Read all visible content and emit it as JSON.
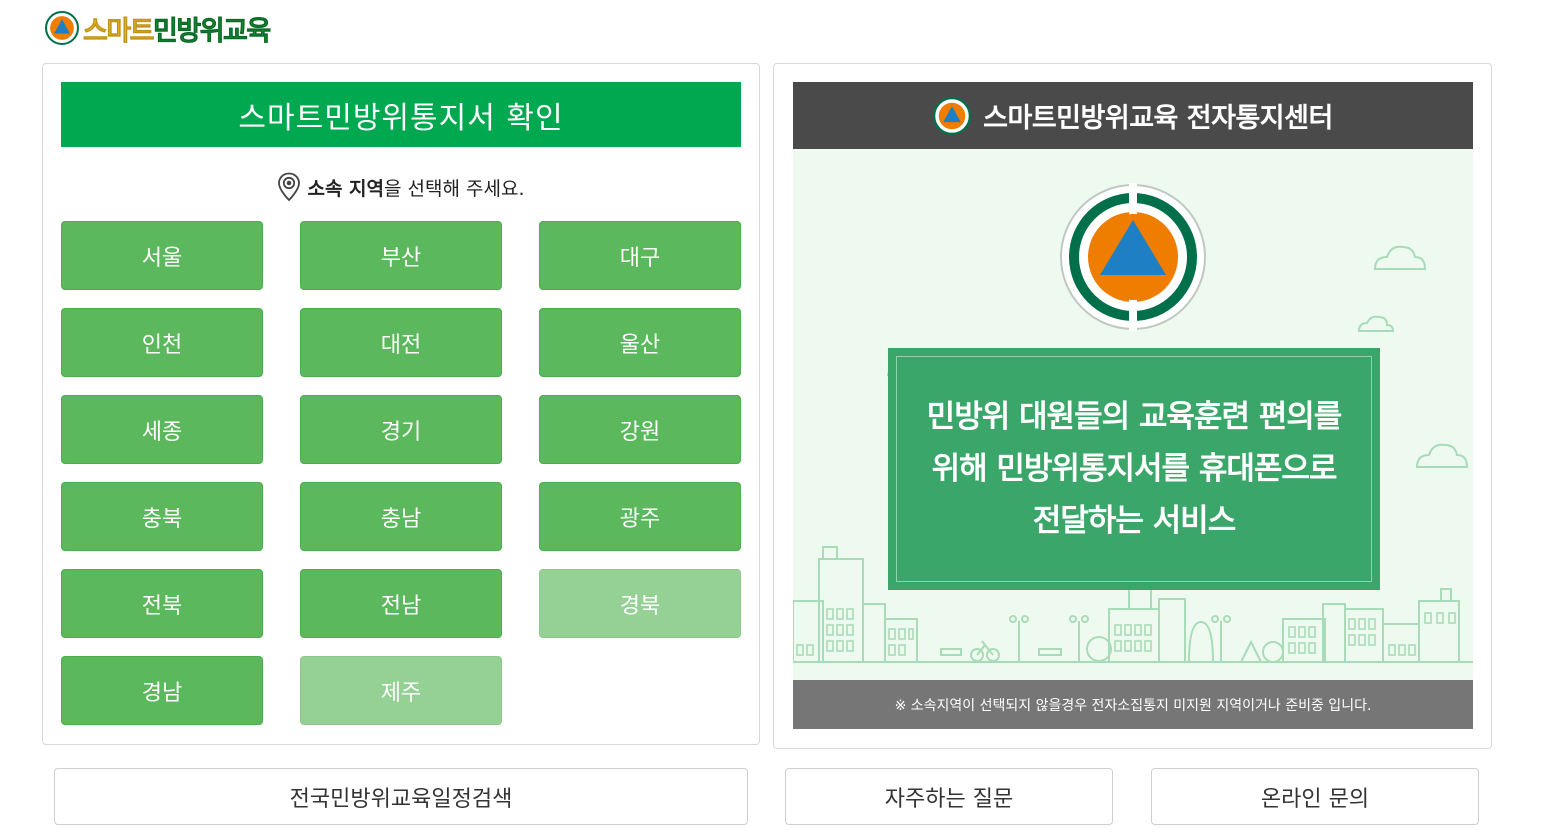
{
  "logo": {
    "text_highlight": "스마트",
    "text_rest": "민방위교육"
  },
  "left_panel": {
    "title": "스마트민방위통지서 확인",
    "prompt_bold": "소속 지역",
    "prompt_rest": "을 선택해 주세요.",
    "regions": [
      {
        "label": "서울",
        "enabled": true
      },
      {
        "label": "부산",
        "enabled": true
      },
      {
        "label": "대구",
        "enabled": true
      },
      {
        "label": "인천",
        "enabled": true
      },
      {
        "label": "대전",
        "enabled": true
      },
      {
        "label": "울산",
        "enabled": true
      },
      {
        "label": "세종",
        "enabled": true
      },
      {
        "label": "경기",
        "enabled": true
      },
      {
        "label": "강원",
        "enabled": true
      },
      {
        "label": "충북",
        "enabled": true
      },
      {
        "label": "충남",
        "enabled": true
      },
      {
        "label": "광주",
        "enabled": true
      },
      {
        "label": "전북",
        "enabled": true
      },
      {
        "label": "전남",
        "enabled": true
      },
      {
        "label": "경북",
        "enabled": false
      },
      {
        "label": "경남",
        "enabled": true
      },
      {
        "label": "제주",
        "enabled": false
      }
    ]
  },
  "right_panel": {
    "title": "스마트민방위교육 전자통지센터",
    "description_lines": [
      "민방위 대원들의 교육훈련 편의를",
      "위해 민방위통지서를 휴대폰으로",
      "전달하는 서비스"
    ],
    "notice": "※ 소속지역이 선택되지 않을경우 전자소집통지 미지원 지역이거나 준비중 입니다."
  },
  "bottom_buttons": {
    "schedule": "전국민방위교육일정검색",
    "faq": "자주하는 질문",
    "inquiry": "온라인 문의"
  },
  "colors": {
    "primary_green": "#00a84f",
    "region_button": "#5cb85c",
    "region_button_disabled": "#95d195",
    "header_dark": "#4a4a4a",
    "notice_bar": "#767676",
    "emblem_orange": "#ef7d00",
    "emblem_blue": "#1e7fc5",
    "emblem_green": "#00704a"
  },
  "icons": {
    "logo": "civil-defense-emblem-icon",
    "prompt": "map-pin-icon"
  }
}
